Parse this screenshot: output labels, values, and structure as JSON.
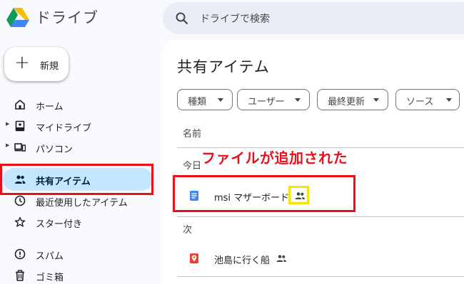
{
  "header": {
    "app_title": "ドライブ",
    "search_placeholder": "ドライブで検索"
  },
  "new_button": {
    "label": "新規"
  },
  "sidebar": {
    "items": [
      {
        "label": "ホーム",
        "icon": "home-icon"
      },
      {
        "label": "マイドライブ",
        "icon": "drive-icon",
        "expandable": true
      },
      {
        "label": "パソコン",
        "icon": "computer-icon",
        "expandable": true
      },
      {
        "label": "共有アイテム",
        "icon": "people-icon",
        "active": true
      },
      {
        "label": "最近使用したアイテム",
        "icon": "clock-icon"
      },
      {
        "label": "スター付き",
        "icon": "star-icon"
      },
      {
        "label": "スパム",
        "icon": "spam-icon"
      },
      {
        "label": "ゴミ箱",
        "icon": "trash-icon"
      }
    ]
  },
  "main": {
    "title": "共有アイテム",
    "filters": [
      "種類",
      "ユーザー",
      "最終更新",
      "ソース"
    ],
    "column_header": "名前",
    "groups": [
      {
        "label": "今日",
        "files": [
          {
            "name": "msi マザーボード",
            "icon": "docs-icon",
            "shared": true
          }
        ]
      },
      {
        "label": "次",
        "files": [
          {
            "name": "池島に行く船",
            "icon": "map-pin-icon",
            "shared": true
          }
        ]
      }
    ]
  },
  "annotation": {
    "text": "ファイルが追加された",
    "color": "#e8101a",
    "highlight_color": "#f2e500"
  },
  "colors": {
    "active_nav_bg": "#c2e7ff",
    "search_bg": "#e9eef6",
    "docs_blue": "#4285f4",
    "map_red": "#ea4335"
  }
}
